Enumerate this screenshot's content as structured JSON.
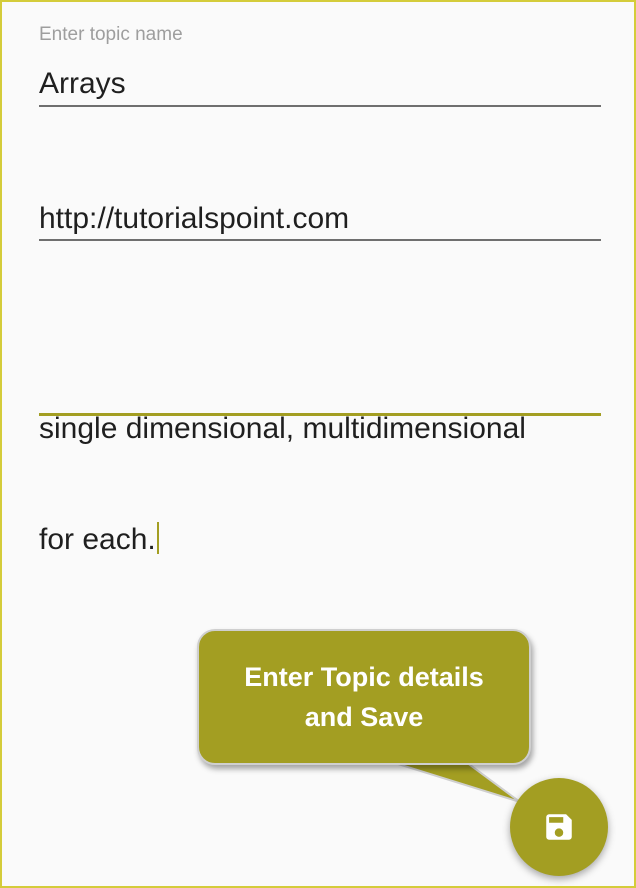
{
  "form": {
    "topic_name": {
      "label": "Enter topic name",
      "value": "Arrays"
    },
    "url": {
      "value": "http://tutorialspoint.com"
    },
    "description": {
      "value_line1": "single dimensional, multidimensional",
      "value_line2": "for each."
    }
  },
  "callout": {
    "line1": "Enter Topic details",
    "line2": "and Save"
  },
  "fab": {
    "icon": "save-icon"
  },
  "colors": {
    "accent": "#a39e22",
    "frame_border": "#d4cc3a",
    "underline": "#6f6f6f",
    "label": "#9e9e9e",
    "text": "#1f1f1f"
  }
}
